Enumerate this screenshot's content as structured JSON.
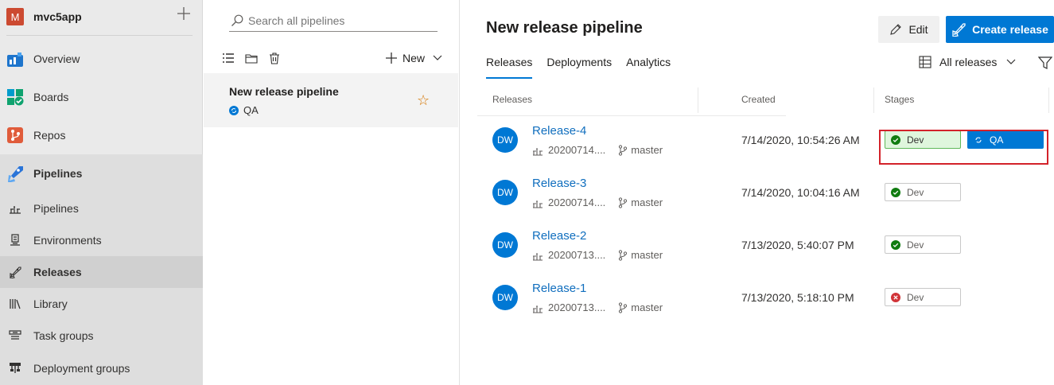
{
  "project": {
    "initial": "M",
    "name": "mvc5app",
    "add_label": "+"
  },
  "nav": {
    "overview": "Overview",
    "boards": "Boards",
    "repos": "Repos",
    "pipelines_section": "Pipelines",
    "sub": {
      "pipelines": "Pipelines",
      "environments": "Environments",
      "releases": "Releases",
      "library": "Library",
      "task_groups": "Task groups",
      "deployment_groups": "Deployment groups"
    }
  },
  "middle": {
    "search_placeholder": "Search all pipelines",
    "new_label": "New",
    "pipeline": {
      "name": "New release pipeline",
      "stage": "QA"
    }
  },
  "main": {
    "title": "New release pipeline",
    "edit_label": "Edit",
    "create_label": "Create release",
    "tabs": [
      "Releases",
      "Deployments",
      "Analytics"
    ],
    "filter_label": "All releases",
    "columns": {
      "releases": "Releases",
      "created": "Created",
      "stages": "Stages"
    },
    "rows": [
      {
        "avatar": "DW",
        "name": "Release-4",
        "build": "20200714....",
        "branch": "master",
        "created": "7/14/2020, 10:54:26 AM",
        "stages": [
          {
            "name": "Dev",
            "status": "succeeded"
          },
          {
            "name": "QA",
            "status": "in-progress"
          }
        ]
      },
      {
        "avatar": "DW",
        "name": "Release-3",
        "build": "20200714....",
        "branch": "master",
        "created": "7/14/2020, 10:04:16 AM",
        "stages": [
          {
            "name": "Dev",
            "status": "succeeded"
          }
        ]
      },
      {
        "avatar": "DW",
        "name": "Release-2",
        "build": "20200713....",
        "branch": "master",
        "created": "7/13/2020, 5:40:07 PM",
        "stages": [
          {
            "name": "Dev",
            "status": "succeeded"
          }
        ]
      },
      {
        "avatar": "DW",
        "name": "Release-1",
        "build": "20200713....",
        "branch": "master",
        "created": "7/13/2020, 5:18:10 PM",
        "stages": [
          {
            "name": "Dev",
            "status": "failed"
          }
        ]
      }
    ]
  },
  "colors": {
    "accent": "#0078d4",
    "success": "#107c10",
    "error": "#d13438",
    "highlight": "#d3222a",
    "favorite": "#d47500"
  },
  "icons": [
    "plus-icon",
    "overview-icon",
    "boards-icon",
    "repos-icon",
    "pipelines-icon",
    "pipelines-sub-icon",
    "environments-icon",
    "releases-icon",
    "library-icon",
    "task-groups-icon",
    "deployment-groups-icon",
    "search-icon",
    "list-view-icon",
    "folder-icon",
    "trash-icon",
    "chevron-down-icon",
    "in-progress-icon",
    "star-icon",
    "pencil-icon",
    "rocket-icon",
    "grid-icon",
    "filter-icon",
    "build-icon",
    "branch-icon",
    "success-icon",
    "failed-icon"
  ]
}
